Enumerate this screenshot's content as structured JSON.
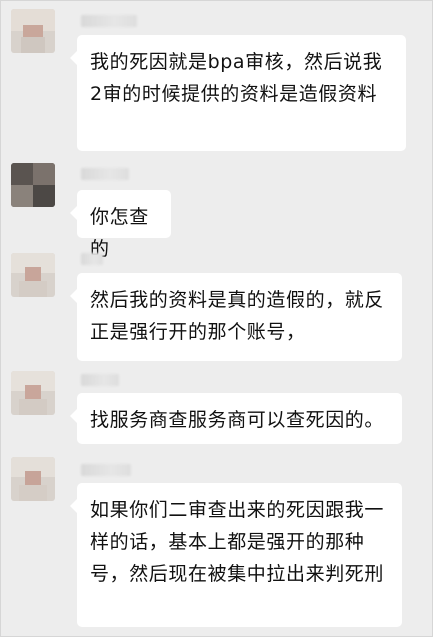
{
  "chat": {
    "messages": [
      {
        "text": "我的死因就是bpa审核，然后说我2审的时候提供的资料是造假资料"
      },
      {
        "text": "你怎查的"
      },
      {
        "text": "然后我的资料是真的造假的，就反正是强行开的那个账号，"
      },
      {
        "text": "找服务商查服务商可以查死因的。"
      },
      {
        "text": "如果你们二审查出来的死因跟我一样的话，基本上都是强开的那种号，然后现在被集中拉出来判死刑"
      }
    ]
  }
}
